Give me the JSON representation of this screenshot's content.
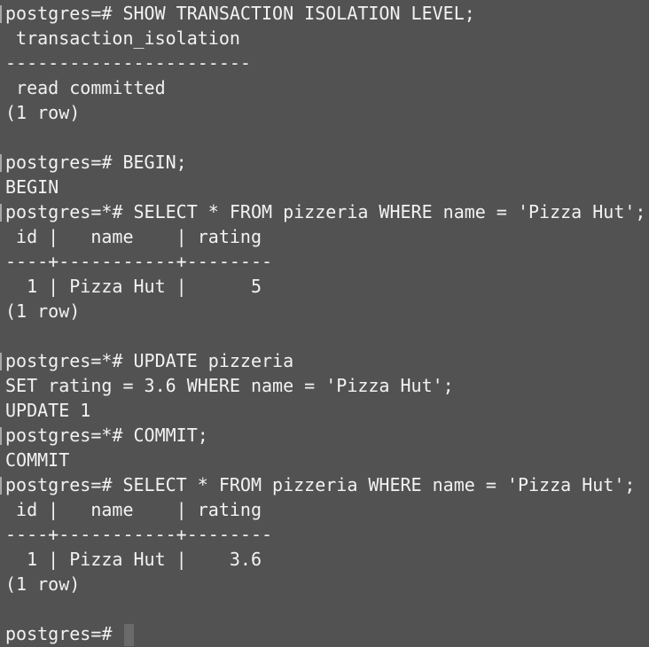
{
  "terminal": {
    "lines": [
      "postgres=# SHOW TRANSACTION ISOLATION LEVEL;",
      " transaction_isolation",
      "-----------------------",
      " read committed",
      "(1 row)",
      "",
      "postgres=# BEGIN;",
      "BEGIN",
      "postgres=*# SELECT * FROM pizzeria WHERE name = 'Pizza Hut';",
      " id |   name    | rating",
      "----+-----------+--------",
      "  1 | Pizza Hut |      5",
      "(1 row)",
      "",
      "postgres=*# UPDATE pizzeria",
      "SET rating = 3.6 WHERE name = 'Pizza Hut';",
      "UPDATE 1",
      "postgres=*# COMMIT;",
      "COMMIT",
      "postgres=# SELECT * FROM pizzeria WHERE name = 'Pizza Hut';",
      " id |   name    | rating",
      "----+-----------+--------",
      "  1 | Pizza Hut |    3.6",
      "(1 row)",
      "",
      "postgres=# "
    ]
  }
}
